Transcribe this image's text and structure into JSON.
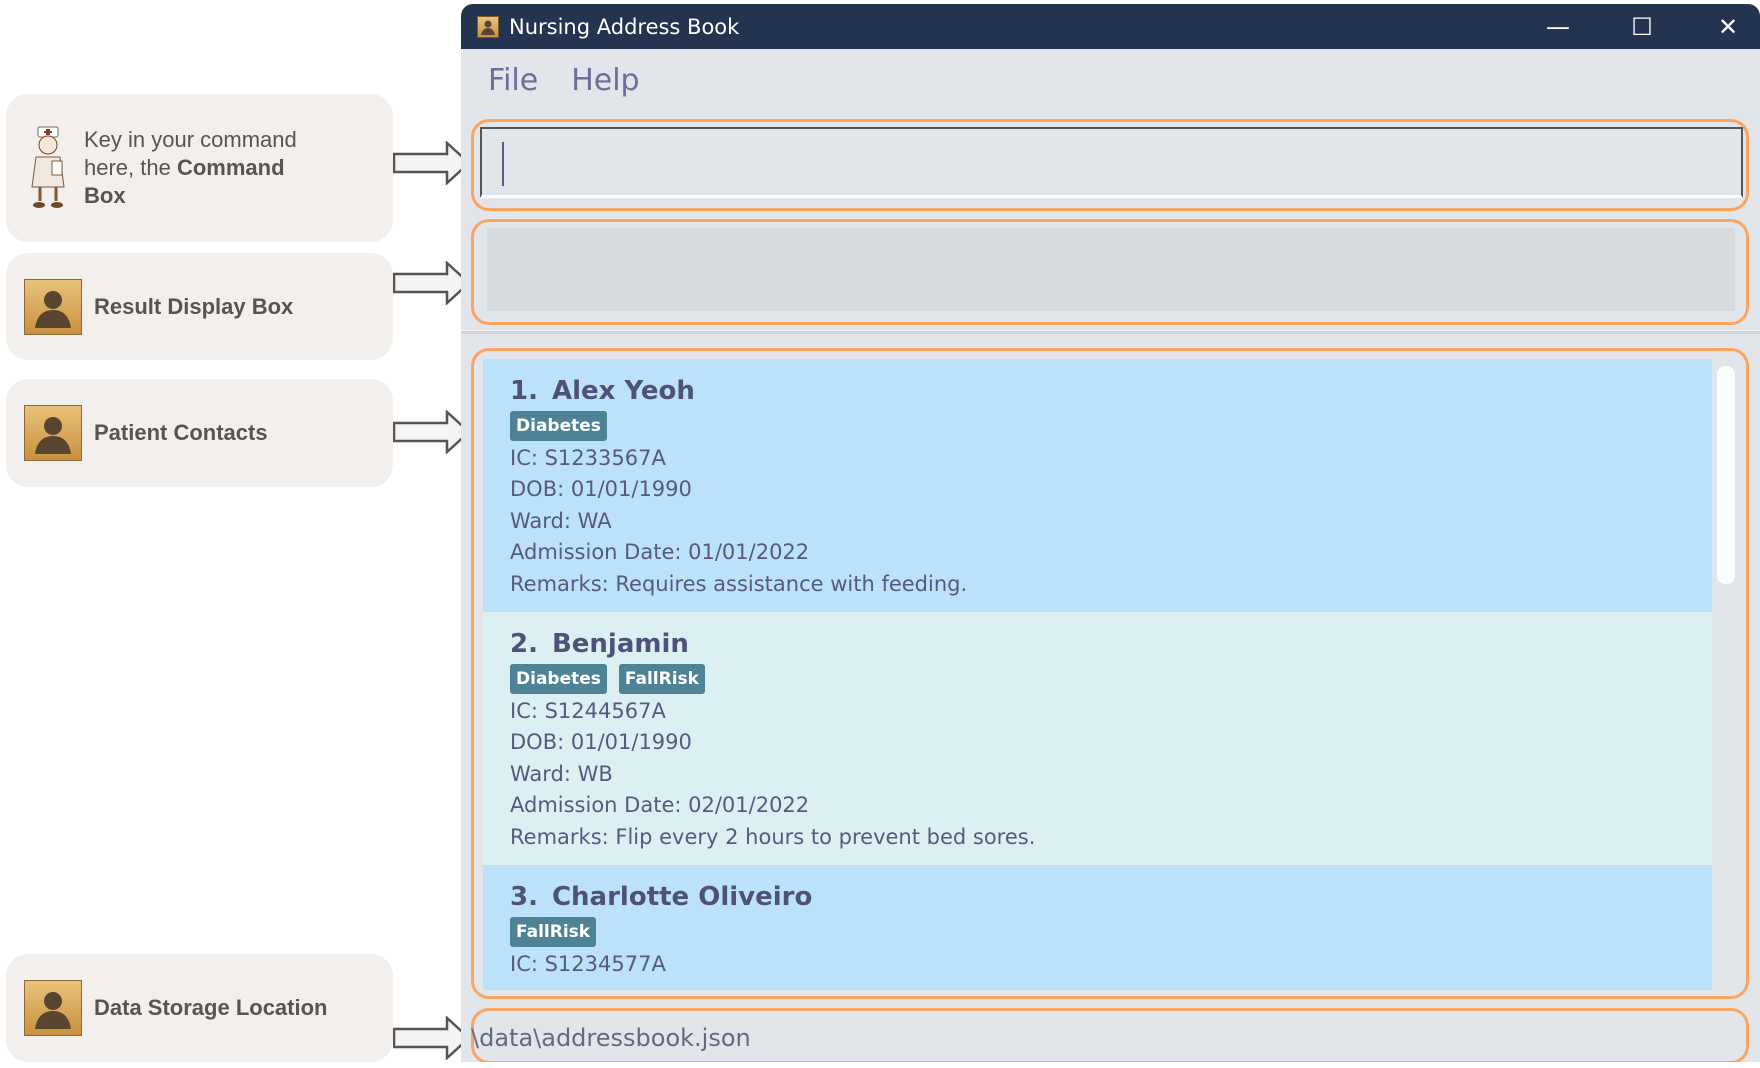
{
  "callouts": [
    {
      "text_pre": "Key in your command here, the ",
      "bold": "Command Box",
      "icon": "nurse-icon"
    },
    {
      "bold": "Result Display Box",
      "icon": "person-icon"
    },
    {
      "bold": "Patient Contacts",
      "icon": "person-icon"
    },
    {
      "bold": "Data Storage Location",
      "icon": "person-icon"
    }
  ],
  "window": {
    "title": "Nursing Address Book",
    "minimize": "—",
    "maximize": "☐",
    "close": "✕"
  },
  "menu": {
    "file": "File",
    "help": "Help"
  },
  "command_box": {
    "value": "",
    "placeholder": ""
  },
  "result_display": {
    "text": ""
  },
  "patients": [
    {
      "index": "1.",
      "name": "Alex Yeoh",
      "tags": [
        "Diabetes"
      ],
      "ic": "IC: S1233567A",
      "dob": "DOB: 01/01/1990",
      "ward": "Ward: WA",
      "admission": "Admission Date: 01/01/2022",
      "remarks": "Remarks: Requires assistance with feeding."
    },
    {
      "index": "2.",
      "name": "Benjamin",
      "tags": [
        "Diabetes",
        "FallRisk"
      ],
      "ic": "IC: S1244567A",
      "dob": "DOB: 01/01/1990",
      "ward": "Ward: WB",
      "admission": "Admission Date: 02/01/2022",
      "remarks": "Remarks: Flip every 2 hours to prevent bed sores."
    },
    {
      "index": "3.",
      "name": "Charlotte Oliveiro",
      "tags": [
        "FallRisk"
      ],
      "ic": "IC: S1234577A"
    }
  ],
  "status_bar": {
    "path": "\\data\\addressbook.json"
  },
  "colors": {
    "titlebar": "#243450",
    "highlight": "#fba561",
    "card_odd": "#bbe2fa",
    "card_even": "#dcf0f3",
    "tag": "#4e8395"
  }
}
